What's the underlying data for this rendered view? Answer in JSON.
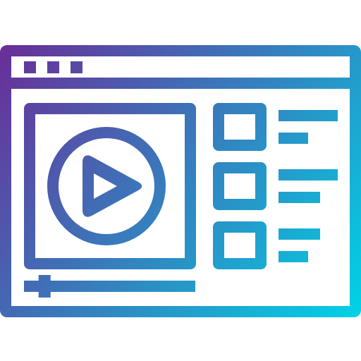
{
  "icon": {
    "name": "video-player-window-icon",
    "gradient": {
      "start": "#6a2d97",
      "end": "#00d3e6"
    },
    "background": "#ffffff",
    "window_dots": 3,
    "playlist_items": 3,
    "progress": 0.12
  }
}
